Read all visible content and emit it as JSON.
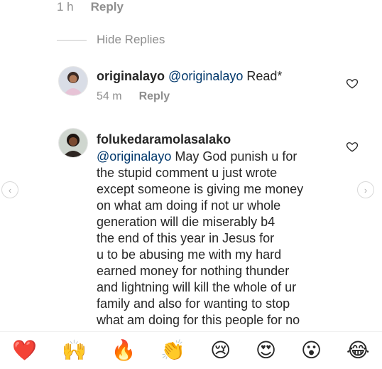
{
  "top_meta": {
    "time": "1 h",
    "reply_label": "Reply"
  },
  "hide_replies_label": "Hide Replies",
  "comment1": {
    "username": "originalayo",
    "mention": "@originalayo",
    "text": "Read*",
    "time": "54 m",
    "reply_label": "Reply"
  },
  "comment2": {
    "username": "folukedaramolasalako",
    "mention": "@originalayo",
    "lines": [
      " May God punish u for",
      "the stupid comment u just wrote",
      "except someone is giving me money",
      "on what am doing if not ur whole",
      "generation will die miserably b4",
      "the end of this year in Jesus for",
      "u to be abusing me with my hard",
      "earned money for nothing thunder",
      "and lightning will kill the whole of ur",
      "family and also for wanting to stop",
      "what am doing for this people for no"
    ]
  },
  "reactions": [
    {
      "name": "heart",
      "glyph": "❤️"
    },
    {
      "name": "raised-hands",
      "glyph": "🙌"
    },
    {
      "name": "fire",
      "glyph": "🔥"
    },
    {
      "name": "clapping-hands",
      "glyph": "👏"
    },
    {
      "name": "crying-face",
      "glyph": "😢"
    },
    {
      "name": "heart-eyes",
      "glyph": "😍"
    },
    {
      "name": "surprised-face",
      "glyph": "😮"
    },
    {
      "name": "tears-of-joy",
      "glyph": "😂"
    }
  ],
  "colors": {
    "link": "#00376b",
    "muted": "#8e8e8e",
    "text": "#262626"
  }
}
